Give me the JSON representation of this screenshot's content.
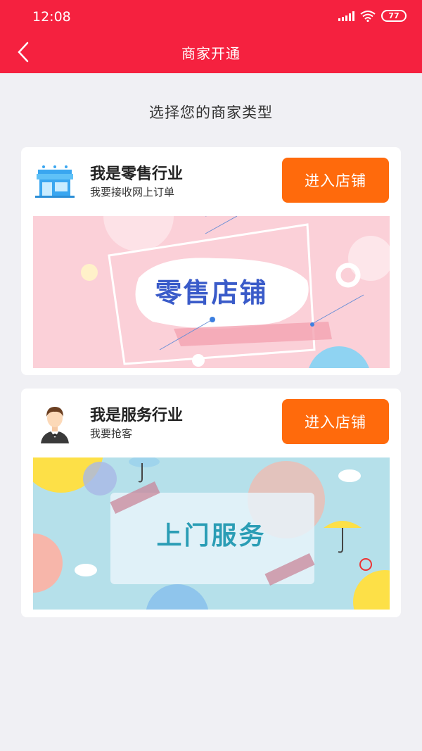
{
  "status_bar": {
    "time": "12:08",
    "battery": "77"
  },
  "nav": {
    "title": "商家开通"
  },
  "page": {
    "heading": "选择您的商家类型"
  },
  "cards": [
    {
      "title": "我是零售行业",
      "subtitle": "我要接收网上订单",
      "button_label": "进入店铺",
      "banner_text": "零售店铺",
      "icon": "store-icon"
    },
    {
      "title": "我是服务行业",
      "subtitle": "我要抢客",
      "button_label": "进入店铺",
      "banner_text": "上门服务",
      "icon": "waiter-icon"
    }
  ],
  "colors": {
    "header": "#f5213f",
    "button": "#ff6a0c",
    "background": "#f0f0f4"
  }
}
